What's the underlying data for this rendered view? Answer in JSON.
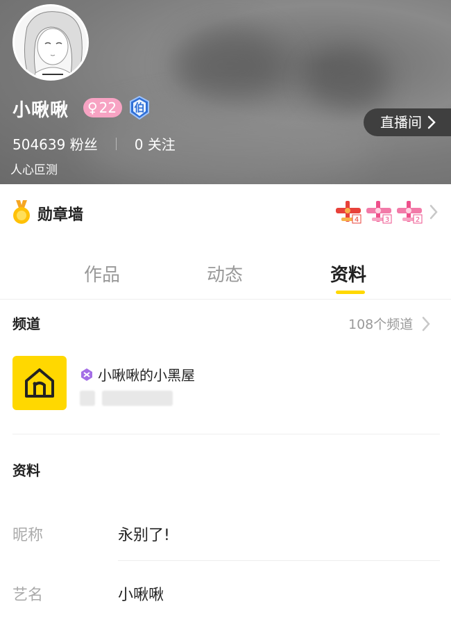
{
  "header": {
    "username": "小啾啾",
    "gender_symbol": "♀",
    "age": "22",
    "level_badge_text": "伯",
    "followers_count": "504639",
    "followers_label": "粉丝",
    "following_count": "0",
    "following_label": "关注",
    "bio": "人心叵测",
    "live_room_label": "直播间"
  },
  "medal_wall": {
    "title": "勋章墙",
    "badges": [
      {
        "icon": "red-plane-badge",
        "level": "4"
      },
      {
        "icon": "pink-plane-badge",
        "level": "3"
      },
      {
        "icon": "pink-plane-badge",
        "level": "2"
      }
    ]
  },
  "tabs": [
    {
      "label": "作品",
      "active": false
    },
    {
      "label": "动态",
      "active": false
    },
    {
      "label": "资料",
      "active": true
    }
  ],
  "channel": {
    "section_title": "频道",
    "count_label": "108个频道",
    "item_name": "小啾啾的小黑屋"
  },
  "profile": {
    "section_title": "资料",
    "fields": [
      {
        "label": "昵称",
        "value": "永别了!"
      },
      {
        "label": "艺名",
        "value": "小啾啾"
      }
    ]
  },
  "colors": {
    "accent_yellow": "#ffd800",
    "gender_pink": "#f7a3c3",
    "level_blue": "#2f6fd6"
  }
}
